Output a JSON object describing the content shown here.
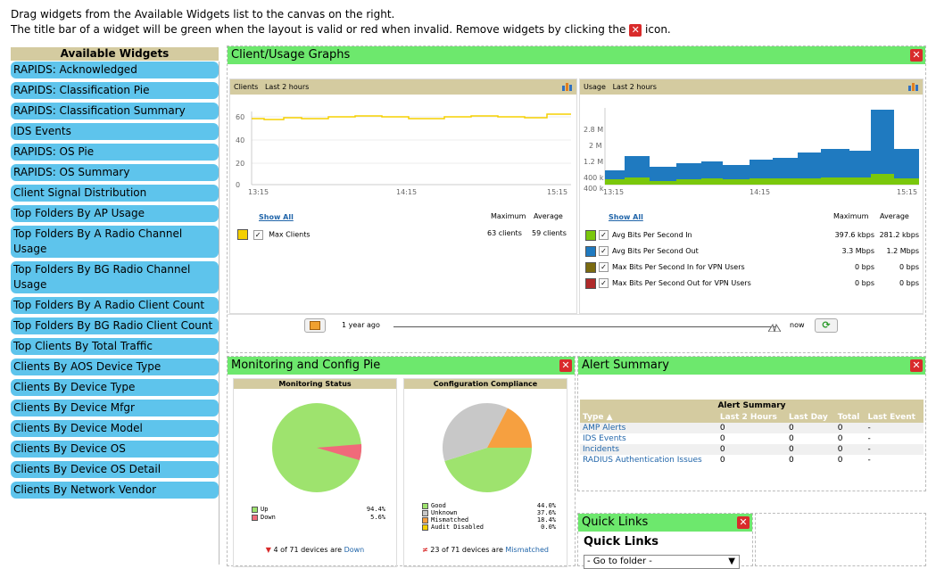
{
  "instructions": {
    "line1": "Drag widgets from the Available Widgets list to the canvas on the right.",
    "line2_pre": "The title bar of a widget will be green when the layout is valid or red when invalid. Remove widgets by clicking the",
    "line2_post": "icon."
  },
  "close_glyph": "✕",
  "available_widgets": {
    "header": "Available Widgets",
    "items": [
      "RAPIDS: Acknowledged",
      "RAPIDS: Classification Pie",
      "RAPIDS: Classification Summary",
      "IDS Events",
      "RAPIDS: OS Pie",
      "RAPIDS: OS Summary",
      "Client Signal Distribution",
      "Top Folders By AP Usage",
      "Top Folders By A Radio Channel Usage",
      "Top Folders By BG Radio Channel Usage",
      "Top Folders By A Radio Client Count",
      "Top Folders By BG Radio Client Count",
      "Top Clients By Total Traffic",
      "Clients By AOS Device Type",
      "Clients By Device Type",
      "Clients By Device Mfgr",
      "Clients By Device Model",
      "Clients By Device OS",
      "Clients By Device OS Detail",
      "Clients By Network Vendor"
    ]
  },
  "client_usage": {
    "title": "Client/Usage Graphs",
    "clients_graph": {
      "label": "Clients",
      "range": "Last 2 hours",
      "y_ticks": [
        "60",
        "40",
        "20",
        "0"
      ],
      "x_ticks": [
        "13:15",
        "14:15",
        "15:15"
      ],
      "show_all": "Show All",
      "col_max": "Maximum",
      "col_avg": "Average",
      "series": [
        {
          "name": "Max Clients",
          "max": "63 clients",
          "avg": "59 clients",
          "color": "#f5d000"
        }
      ]
    },
    "usage_graph": {
      "label": "Usage",
      "range": "Last 2 hours",
      "y_ticks": [
        "2.8 M",
        "2 M",
        "1.2 M",
        "400 k",
        "400 k"
      ],
      "x_ticks": [
        "13:15",
        "14:15",
        "15:15"
      ],
      "show_all": "Show All",
      "col_max": "Maximum",
      "col_avg": "Average",
      "series": [
        {
          "name": "Avg Bits Per Second In",
          "max": "397.6 kbps",
          "avg": "281.2 kbps",
          "color": "#7ac70c"
        },
        {
          "name": "Avg Bits Per Second Out",
          "max": "3.3 Mbps",
          "avg": "1.2 Mbps",
          "color": "#1f7ac0"
        },
        {
          "name": "Max Bits Per Second In for VPN Users",
          "max": "0 bps",
          "avg": "0 bps",
          "color": "#7a6a10"
        },
        {
          "name": "Max Bits Per Second Out for VPN Users",
          "max": "0 bps",
          "avg": "0 bps",
          "color": "#b02a2a"
        }
      ]
    },
    "slider": {
      "left_label": "1 year ago",
      "right_label": "now"
    }
  },
  "monitoring_pie": {
    "title": "Monitoring and Config Pie",
    "monitoring": {
      "header": "Monitoring Status",
      "legend": [
        {
          "label": "Up",
          "value": "94.4%",
          "color": "#9ee36e"
        },
        {
          "label": "Down",
          "value": "5.6%",
          "color": "#f06a7a"
        }
      ],
      "footer_pre": "4 of 71 devices are",
      "footer_link": "Down"
    },
    "config": {
      "header": "Configuration Compliance",
      "legend": [
        {
          "label": "Good",
          "value": "44.0%",
          "color": "#9ee36e"
        },
        {
          "label": "Unknown",
          "value": "37.6%",
          "color": "#c8c8c8"
        },
        {
          "label": "Mismatched",
          "value": "18.4%",
          "color": "#f6a040"
        },
        {
          "label": "Audit Disabled",
          "value": "0.0%",
          "color": "#f5d000"
        }
      ],
      "footer_pre": "23 of 71 devices are",
      "footer_link": "Mismatched"
    }
  },
  "alert_summary": {
    "title": "Alert Summary",
    "table_title": "Alert Summary",
    "columns": [
      "Type ▲",
      "Last 2 Hours",
      "Last Day",
      "Total",
      "Last Event"
    ],
    "rows": [
      [
        "AMP Alerts",
        "0",
        "0",
        "0",
        "-"
      ],
      [
        "IDS Events",
        "0",
        "0",
        "0",
        "-"
      ],
      [
        "Incidents",
        "0",
        "0",
        "0",
        "-"
      ],
      [
        "RADIUS Authentication Issues",
        "0",
        "0",
        "0",
        "-"
      ]
    ]
  },
  "quick_links": {
    "title": "Quick Links",
    "heading": "Quick Links",
    "select_value": "- Go to folder -"
  },
  "colors": {
    "title_bar_valid": "#6de86d",
    "widget_item": "#5ec4ec",
    "subhead": "#d4cba0",
    "close": "#d92b2b"
  }
}
